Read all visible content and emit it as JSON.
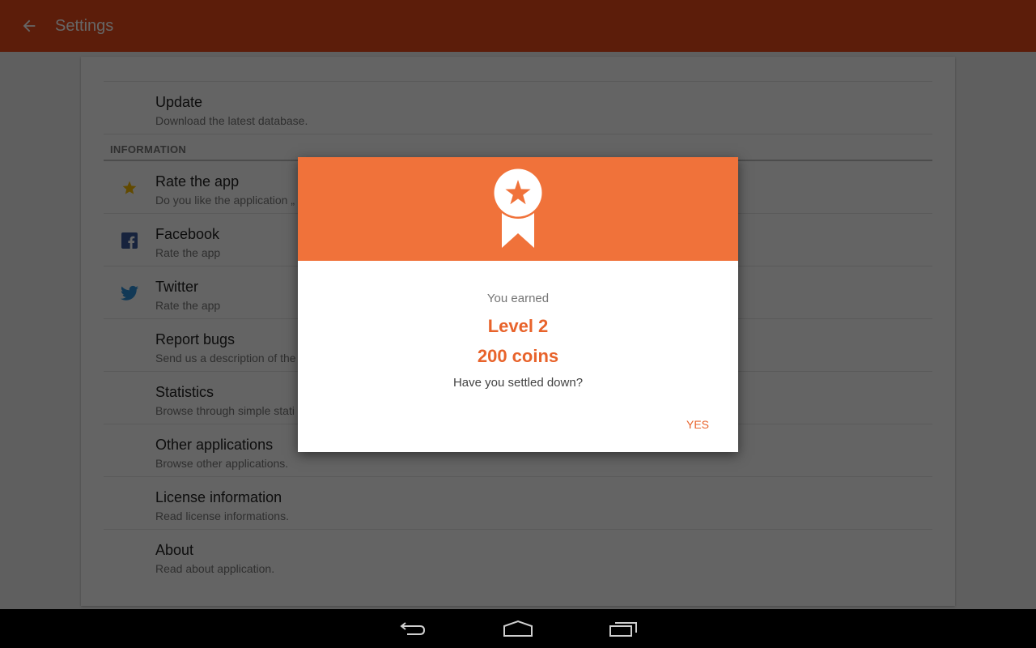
{
  "appbar": {
    "title": "Settings",
    "back_icon": "arrow-back-icon",
    "color": "#e64a19"
  },
  "settings": {
    "top_items": [
      {
        "title": "Update",
        "subtitle": "Download the latest database.",
        "icon": null
      }
    ],
    "section_header": "INFORMATION",
    "info_items": [
      {
        "title": "Rate the app",
        "subtitle": "Do you like the application „",
        "icon": "star-icon"
      },
      {
        "title": "Facebook",
        "subtitle": "Rate the app",
        "icon": "facebook-icon"
      },
      {
        "title": "Twitter",
        "subtitle": "Rate the app",
        "icon": "twitter-icon"
      },
      {
        "title": "Report bugs",
        "subtitle": "Send us a description of the",
        "icon": null
      },
      {
        "title": "Statistics",
        "subtitle": "Browse through simple stati",
        "icon": null
      },
      {
        "title": "Other applications",
        "subtitle": "Browse other applications.",
        "icon": null
      },
      {
        "title": "License information",
        "subtitle": "Read license informations.",
        "icon": null
      },
      {
        "title": "About",
        "subtitle": "Read about application.",
        "icon": null
      }
    ]
  },
  "dialog": {
    "icon": "award-ribbon-icon",
    "earned_label": "You earned",
    "level": "Level 2",
    "coins": "200 coins",
    "question": "Have you settled down?",
    "yes_label": "YES",
    "accent_color": "#e8632b",
    "header_color": "#f0723a"
  },
  "navbar": {
    "back": "nav-back-icon",
    "home": "nav-home-icon",
    "recents": "nav-recents-icon"
  }
}
